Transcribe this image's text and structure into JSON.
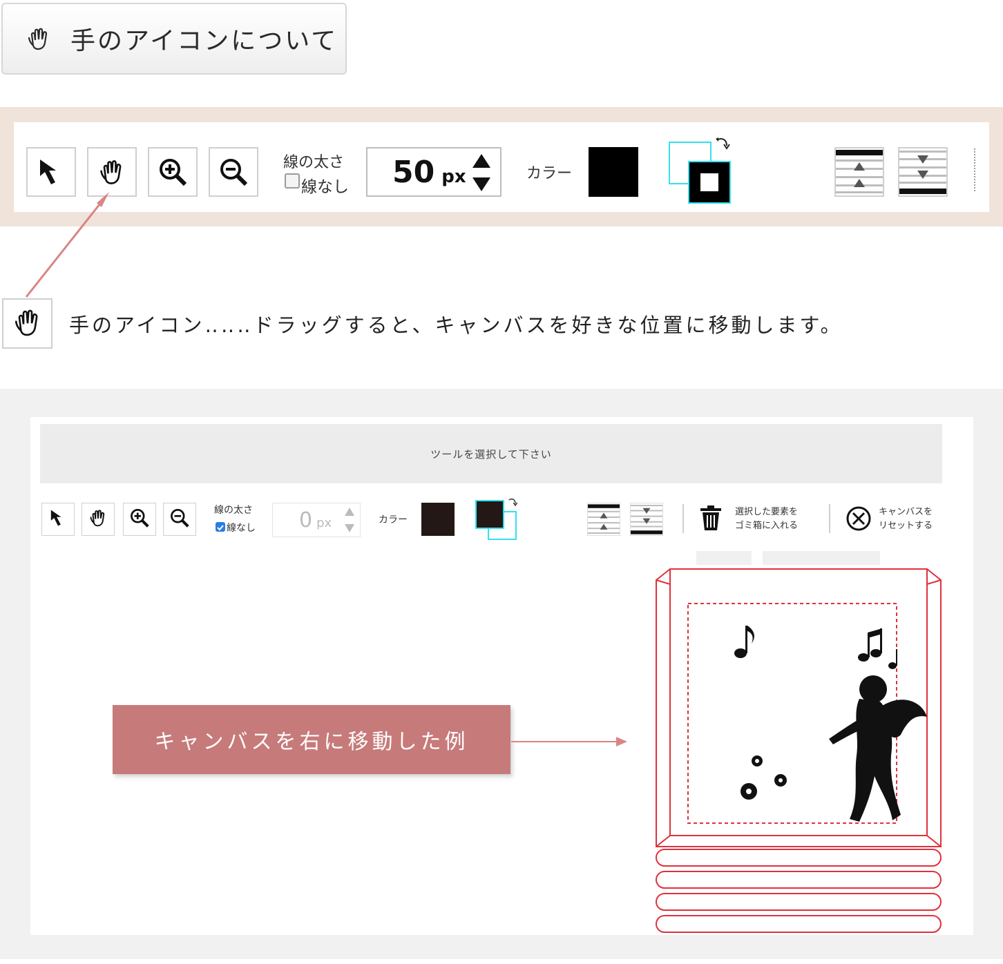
{
  "heading": {
    "title": "手のアイコンについて",
    "icon": "hand-icon"
  },
  "top_toolbar": {
    "line_width_label": "線の太さ",
    "no_line_label": "線なし",
    "no_line_checked": false,
    "line_width_value": "50",
    "line_width_unit": "px",
    "color_label": "カラー",
    "fill_color": "#000000",
    "stroke_color": "#33e0f0"
  },
  "annotation": {
    "icon": "hand-icon",
    "description": "手のアイコン‥‥‥ドラッグすると、キャンバスを好きな位置に移動します。",
    "arrow_color": "#d98585"
  },
  "app": {
    "message": "ツールを選択して下さい",
    "toolbar": {
      "line_width_label": "線の太さ",
      "no_line_label": "線なし",
      "no_line_checked": true,
      "line_width_value": "0",
      "line_width_unit": "px",
      "color_label": "カラー",
      "fill_color": "#231815",
      "delete_label_1": "選択した要素を",
      "delete_label_2": "ゴミ箱に入れる",
      "reset_label_1": "キャンバスを",
      "reset_label_2": "リセットする"
    },
    "callout": "キャンバスを右に移動した例",
    "canvas": {
      "outline_color": "#e0303a"
    }
  }
}
